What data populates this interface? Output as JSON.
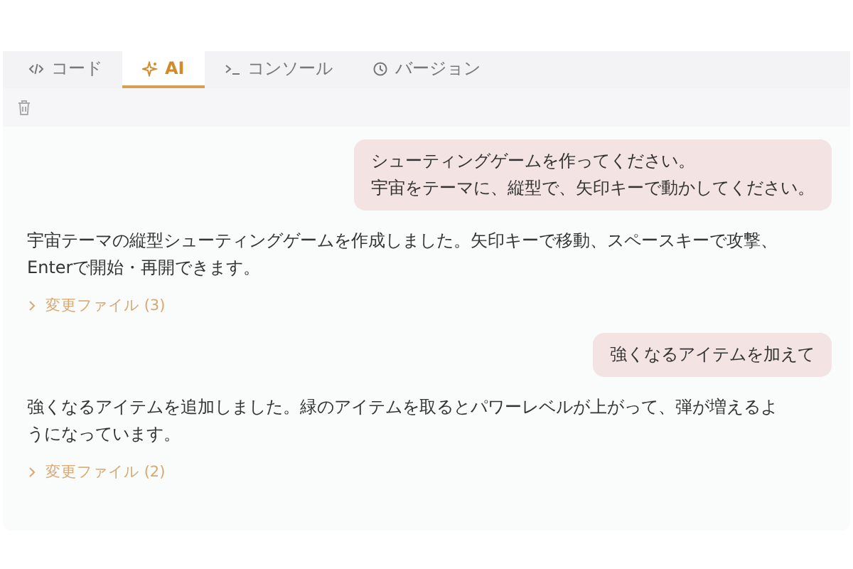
{
  "tabs": [
    {
      "label": "コード",
      "kind": "code",
      "selected": false
    },
    {
      "label": "AI",
      "kind": "sparkle",
      "selected": true
    },
    {
      "label": "コンソール",
      "kind": "terminal",
      "selected": false
    },
    {
      "label": "バージョン",
      "kind": "history",
      "selected": false
    }
  ],
  "messages": [
    {
      "kind": "user",
      "lines": [
        "シューティングゲームを作ってください。",
        "宇宙をテーマに、縦型で、矢印キーで動かしてください。"
      ]
    },
    {
      "kind": "assistant",
      "text": "宇宙テーマの縦型シューティングゲームを作成しました。矢印キーで移動、スペースキーで攻撃、Enterで開始・再開できます。",
      "files_link": "変更ファイル (3)",
      "expanded": false
    },
    {
      "kind": "user",
      "lines": [
        "強くなるアイテムを加えて"
      ]
    },
    {
      "kind": "assistant",
      "text": "強くなるアイテムを追加しました。緑のアイテムを取るとパワーレベルが上がって、弾が増えるようになっています。",
      "files_link": "変更ファイル (2)",
      "expanded": false
    }
  ]
}
